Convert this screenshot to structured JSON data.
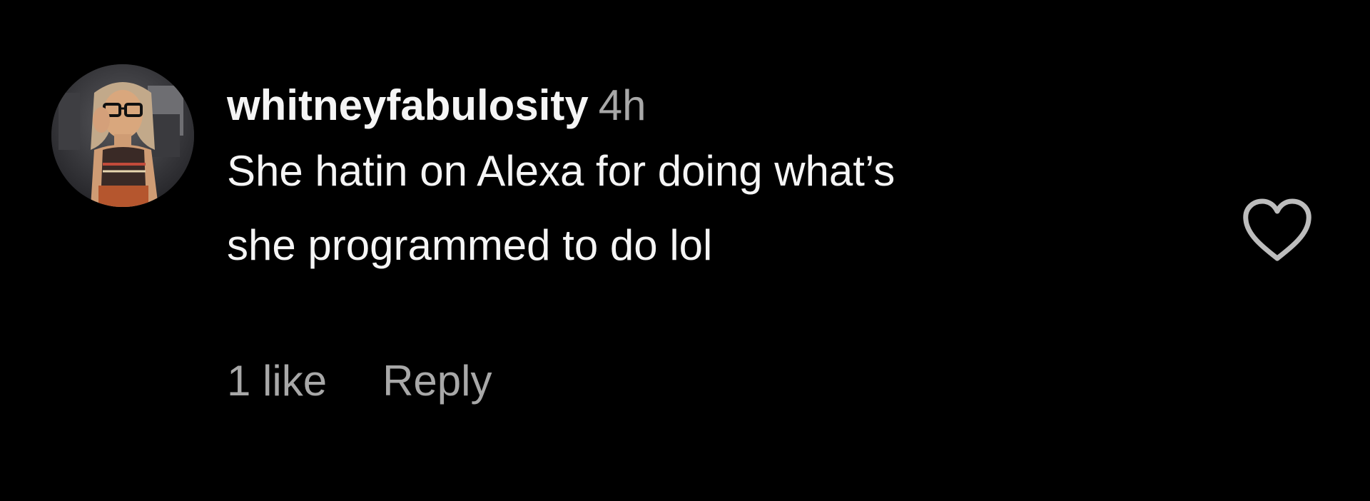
{
  "comment": {
    "username": "whitneyfabulosity",
    "timestamp": "4h",
    "text": "She hatin on Alexa for doing what’s\nshe programmed to do lol",
    "likes_label": "1 like",
    "reply_label": "Reply"
  },
  "icons": {
    "like": "heart-outline-icon",
    "avatar": "profile-photo"
  },
  "colors": {
    "background": "#000000",
    "primary_text": "#f5f5f5",
    "secondary_text": "#a8a8a8",
    "heart_outline": "#bdbdbd"
  }
}
